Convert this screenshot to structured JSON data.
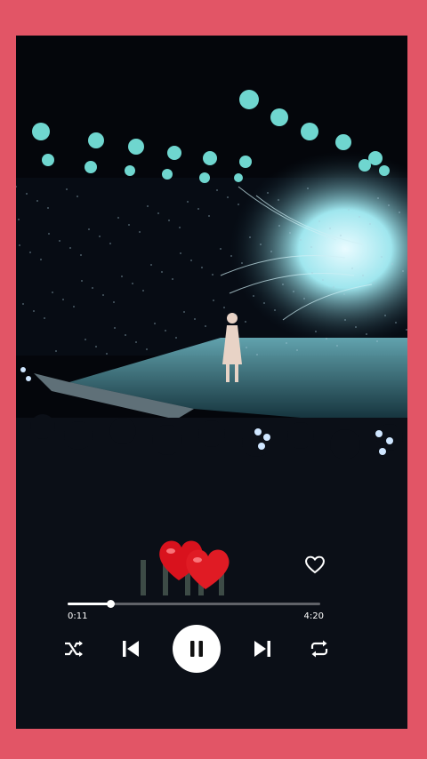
{
  "player": {
    "elapsed": "0:11",
    "total": "4:20",
    "progress_fraction": 0.17,
    "state": "playing"
  },
  "icons": {
    "hearts": "two-red-hearts-icon",
    "favorite": "heart-outline-icon",
    "shuffle": "shuffle-icon",
    "previous": "skip-previous-icon",
    "pause": "pause-icon",
    "next": "skip-next-icon",
    "repeat": "repeat-icon"
  },
  "colors": {
    "border": "#e25566",
    "background": "#04060b",
    "stage_light": "#6fd6cf",
    "heart": "#e01b24",
    "controls": "#ffffff"
  }
}
